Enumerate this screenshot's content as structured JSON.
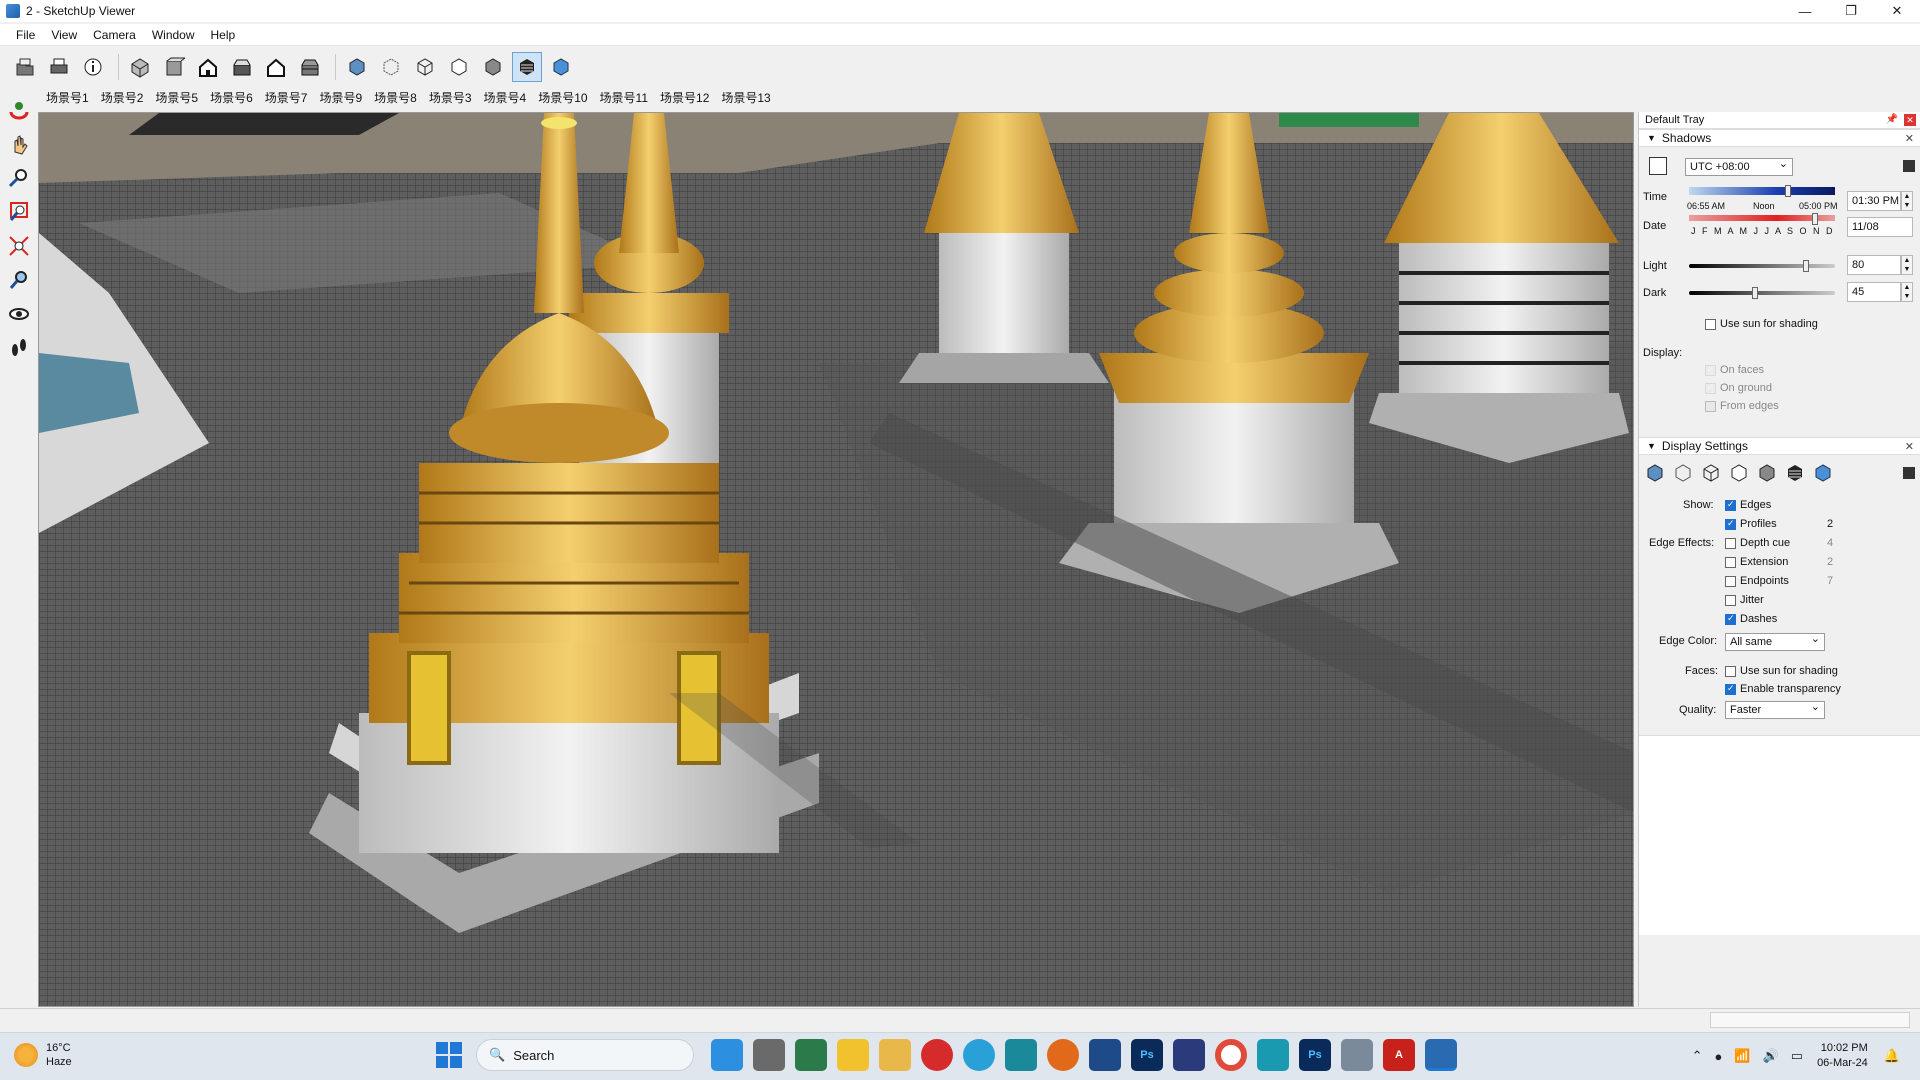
{
  "window": {
    "title": "2 - SketchUp Viewer",
    "controls": [
      "—",
      "❐",
      "✕"
    ]
  },
  "menu": [
    "File",
    "View",
    "Camera",
    "Window",
    "Help"
  ],
  "scenes": [
    "场景号1",
    "场景号2",
    "场景号5",
    "场景号6",
    "场景号7",
    "场景号9",
    "场景号8",
    "场景号3",
    "场景号4",
    "场景号10",
    "场景号11",
    "场景号12",
    "场景号13"
  ],
  "tray": {
    "title": "Default Tray",
    "shadows": {
      "header": "Shadows",
      "timezone": "UTC +08:00",
      "time_label": "Time",
      "time_start": "06:55 AM",
      "time_noon": "Noon",
      "time_end": "05:00 PM",
      "time_value": "01:30 PM",
      "time_fraction": 0.68,
      "date_label": "Date",
      "months": "J F M A M J J A S O N D",
      "date_value": "11/08",
      "date_fraction": 0.86,
      "light_label": "Light",
      "light_value": "80",
      "dark_label": "Dark",
      "dark_value": "45",
      "use_sun": "Use sun for shading",
      "display_label": "Display:",
      "on_faces": "On faces",
      "on_ground": "On ground",
      "from_edges": "From edges"
    },
    "display": {
      "header": "Display Settings",
      "show_label": "Show:",
      "edge_effects_label": "Edge Effects:",
      "edges": "Edges",
      "profiles": "Profiles",
      "profiles_val": "2",
      "depth_cue": "Depth cue",
      "depth_cue_val": "4",
      "extension": "Extension",
      "extension_val": "2",
      "endpoints": "Endpoints",
      "endpoints_val": "7",
      "jitter": "Jitter",
      "dashes": "Dashes",
      "edge_color_label": "Edge Color:",
      "edge_color_value": "All same",
      "faces_label": "Faces:",
      "faces_use_sun": "Use sun for shading",
      "enable_transparency": "Enable transparency",
      "quality_label": "Quality:",
      "quality_value": "Faster"
    }
  },
  "taskbar": {
    "temp": "16°C",
    "weather": "Haze",
    "search": "Search",
    "time": "10:02 PM",
    "date": "06-Mar-24",
    "apps": [
      "Ps",
      "Ps",
      "A"
    ]
  }
}
